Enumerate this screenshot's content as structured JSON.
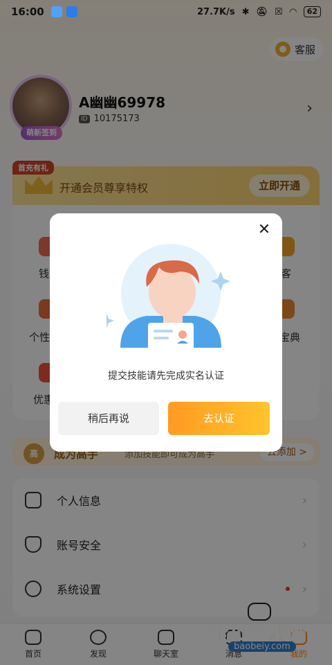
{
  "status_bar": {
    "time": "16:00",
    "network_speed": "27.7K/s",
    "battery": "62"
  },
  "header": {
    "service_label": "客服"
  },
  "profile": {
    "username": "A幽幽69978",
    "user_id": "10175173",
    "avatar_badge": "萌新签到"
  },
  "vip": {
    "tag": "首充有礼",
    "text": "开通会员尊享特权",
    "button": "立即开通"
  },
  "grid": {
    "row1_left": "钱",
    "row1_right": "客",
    "row2_left": "个性",
    "row2_right": "宝典",
    "row3_left": "优惠"
  },
  "master": {
    "icon_text": "高",
    "title": "成为高手",
    "subtitle": "添加技能即可成为高手",
    "button": "去添加 >"
  },
  "menu": {
    "items": [
      {
        "label": "个人信息"
      },
      {
        "label": "账号安全"
      },
      {
        "label": "系统设置"
      }
    ]
  },
  "tabbar": {
    "tabs": [
      {
        "label": "首页"
      },
      {
        "label": "发现"
      },
      {
        "label": "聊天室"
      },
      {
        "label": "消息"
      },
      {
        "label": "我的"
      }
    ]
  },
  "watermark": {
    "text": "宝贝游戏网",
    "url": "baobeiy.com"
  },
  "modal": {
    "message": "提交技能请先完成实名认证",
    "cancel_label": "稍后再说",
    "confirm_label": "去认证",
    "accent_color": "#ffa726"
  }
}
